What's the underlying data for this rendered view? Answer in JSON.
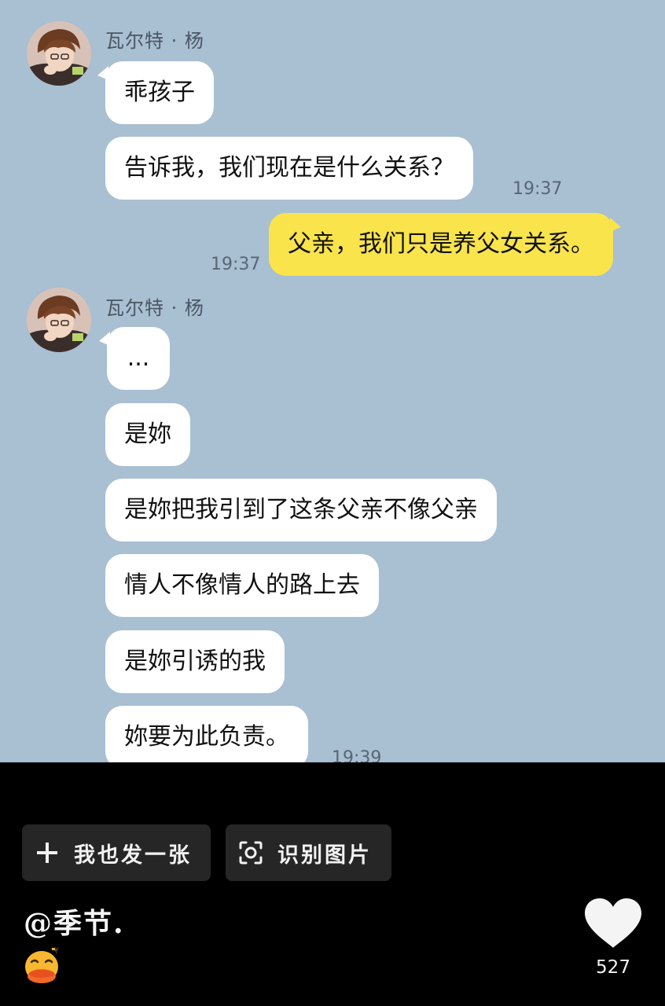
{
  "chat": {
    "sender_name": "瓦尔特 · 杨",
    "messages": [
      {
        "text": "乖孩子"
      },
      {
        "text": "告诉我，我们现在是什么关系？",
        "time": "19:37"
      },
      {
        "text": "父亲，我们只是养父女关系。",
        "time": "19:37",
        "mine": true
      },
      {
        "text": "..."
      },
      {
        "text": "是妳"
      },
      {
        "text": "是妳把我引到了这条父亲不像父亲"
      },
      {
        "text": "情人不像情人的路上去"
      },
      {
        "text": "是妳引诱的我"
      },
      {
        "text": "妳要为此负责。",
        "time": "19:39"
      }
    ],
    "colors": {
      "background": "#a9bfd2",
      "incoming_bubble": "#ffffff",
      "outgoing_bubble": "#f9e44c"
    }
  },
  "actions": {
    "post_too_label": "我也发一张",
    "post_too_icon": "plus-icon",
    "recognize_label": "识别图片",
    "recognize_icon": "scan-icon"
  },
  "post": {
    "author": "@季节.",
    "emoji": "duck-emoji"
  },
  "like": {
    "icon": "heart-icon",
    "count": "527"
  }
}
